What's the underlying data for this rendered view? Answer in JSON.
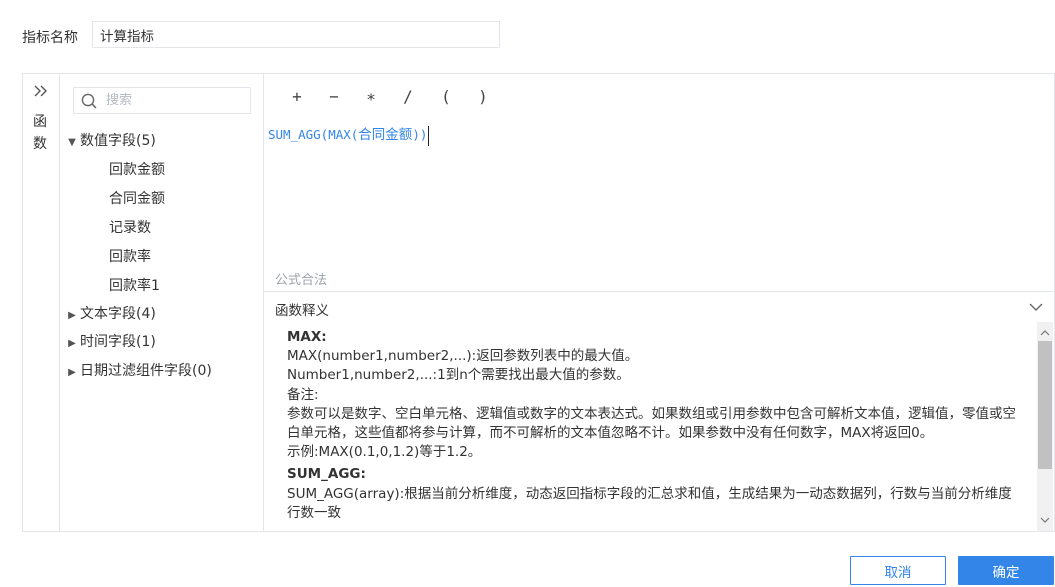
{
  "indicator": {
    "label": "指标名称",
    "value": "计算指标"
  },
  "functions_strip": {
    "collapse_icon": "double-chevron-right-icon",
    "label_line1": "函",
    "label_line2": "数"
  },
  "search": {
    "placeholder": "搜索",
    "icon": "search-icon"
  },
  "field_tree": {
    "numeric": {
      "label": "数值字段(5)",
      "expanded": true
    },
    "numeric_items": [
      "回款金额",
      "合同金额",
      "记录数",
      "回款率",
      "回款率1"
    ],
    "text": {
      "label": "文本字段(4)",
      "expanded": false
    },
    "time": {
      "label": "时间字段(1)",
      "expanded": false
    },
    "date_filter": {
      "label": "日期过滤组件字段(0)",
      "expanded": false
    }
  },
  "operators": [
    "+",
    "−",
    "∗",
    "/",
    "(",
    ")"
  ],
  "formula": {
    "prefix": "SUM_AGG(MAX(",
    "field": "合同金额",
    "suffix": "))"
  },
  "formula_status": "公式合法",
  "explain": {
    "title": "函数释义",
    "toggle_icon": "chevron-down-icon",
    "max_name": "MAX:",
    "max_lines": [
      "MAX(number1,number2,...):返回参数列表中的最大值。",
      "Number1,number2,...:1到n个需要找出最大值的参数。",
      "备注:",
      "参数可以是数字、空白单元格、逻辑值或数字的文本表达式。如果数组或引用参数中包含可解析文本值，逻辑值，零值或空白单元格，这些值都将参与计算，而不可解析的文本值忽略不计。如果参数中没有任何数字，MAX将返回0。",
      "示例:MAX(0.1,0,1.2)等于1.2。"
    ],
    "sumagg_name": "SUM_AGG:",
    "sumagg_lines": [
      "SUM_AGG(array):根据当前分析维度，动态返回指标字段的汇总求和值，生成结果为一动态数据列，行数与当前分析维度行数一致"
    ]
  },
  "buttons": {
    "cancel": "取消",
    "ok": "确定"
  },
  "colors": {
    "accent": "#3385e8",
    "border": "#e3e6ea",
    "muted": "#9da3ab"
  }
}
